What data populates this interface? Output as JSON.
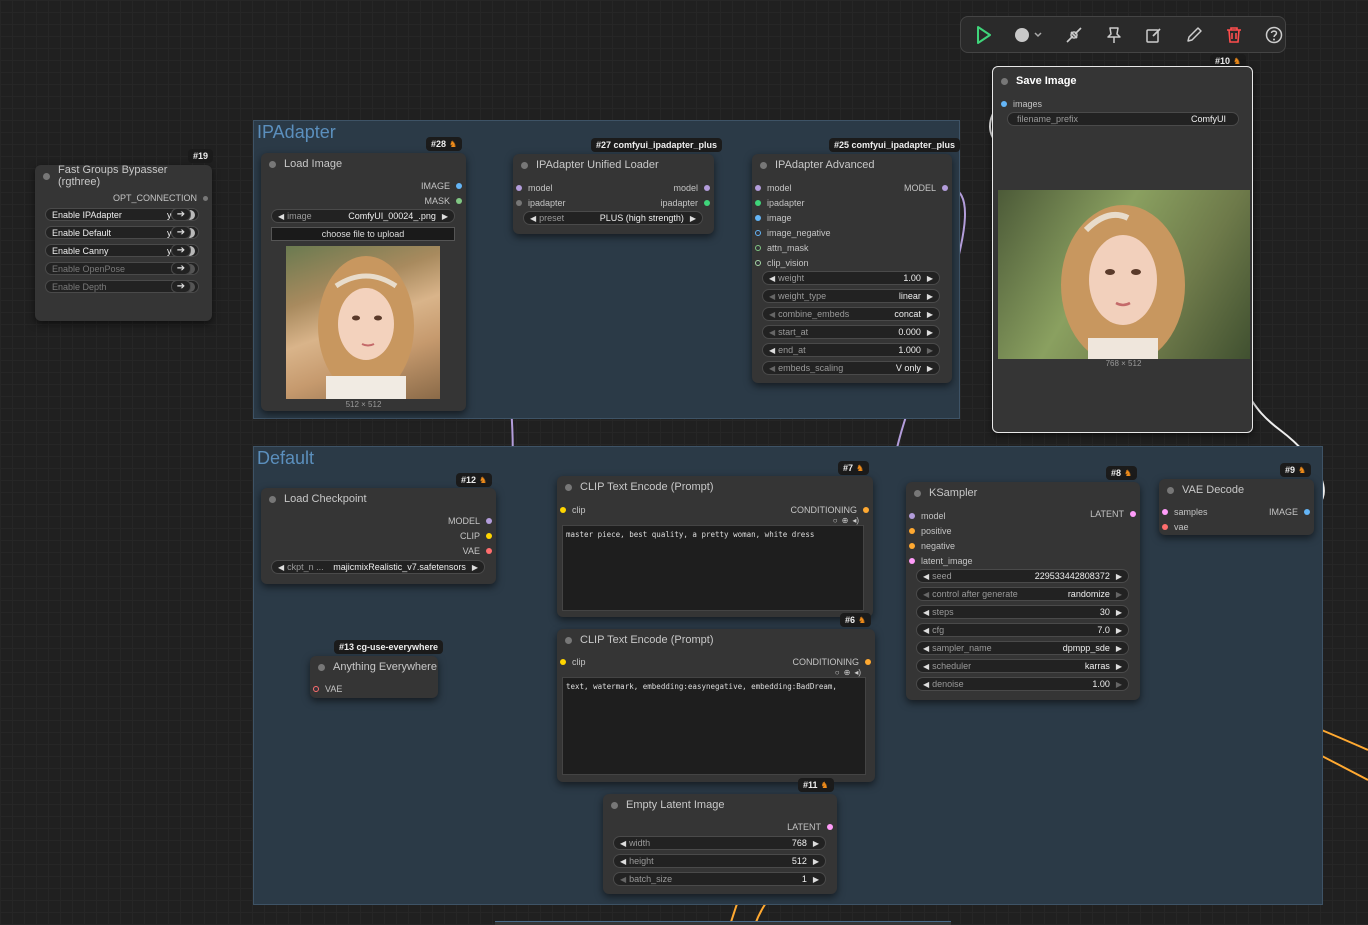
{
  "colors": {
    "model": "#b39ddb",
    "clip": "#ffd500",
    "vae": "#ff6e6e",
    "image": "#64b5f6",
    "conditioning": "#ffa931",
    "latent": "#ff9cf9",
    "ipadapter": "#3fd47a",
    "mask": "#81c784"
  },
  "toolbar": {
    "icons": [
      "play-icon",
      "color-circle-icon",
      "bypass-icon",
      "pin-icon",
      "edit-icon",
      "pencil-icon",
      "delete-icon",
      "help-icon"
    ]
  },
  "groups": {
    "ipadapter": {
      "title": "IPAdapter"
    },
    "default": {
      "title": "Default"
    }
  },
  "bypasser": {
    "badge": "#19",
    "title": "Fast Groups Bypasser (rgthree)",
    "output": "OPT_CONNECTION",
    "rows": [
      {
        "label": "Enable IPAdapter",
        "value": "yes",
        "on": true
      },
      {
        "label": "Enable Default",
        "value": "yes",
        "on": true
      },
      {
        "label": "Enable Canny",
        "value": "yes",
        "on": true
      },
      {
        "label": "Enable OpenPose",
        "value": "no",
        "on": false
      },
      {
        "label": "Enable Depth",
        "value": "no",
        "on": false
      }
    ]
  },
  "load_image": {
    "badge": "#28",
    "title": "Load Image",
    "outputs": [
      "IMAGE",
      "MASK"
    ],
    "image_label": "image",
    "image_value": "ComfyUI_00024_.png",
    "upload_label": "choose file to upload",
    "caption": "512 × 512"
  },
  "unified_loader": {
    "badge": "#27 comfyui_ipadapter_plus",
    "title": "IPAdapter Unified Loader",
    "inputs": [
      "model",
      "ipadapter"
    ],
    "outputs": [
      "model",
      "ipadapter"
    ],
    "preset_label": "preset",
    "preset_value": "PLUS (high strength)"
  },
  "ipadapter_advanced": {
    "badge": "#25 comfyui_ipadapter_plus",
    "title": "IPAdapter Advanced",
    "inputs": [
      "model",
      "ipadapter",
      "image",
      "image_negative",
      "attn_mask",
      "clip_vision"
    ],
    "output": "MODEL",
    "widgets": [
      {
        "label": "weight",
        "value": "1.00"
      },
      {
        "label": "weight_type",
        "value": "linear"
      },
      {
        "label": "combine_embeds",
        "value": "concat"
      },
      {
        "label": "start_at",
        "value": "0.000"
      },
      {
        "label": "end_at",
        "value": "1.000"
      },
      {
        "label": "embeds_scaling",
        "value": "V only"
      }
    ]
  },
  "save_image": {
    "badge": "#10",
    "title": "Save Image",
    "input": "images",
    "prefix_label": "filename_prefix",
    "prefix_value": "ComfyUI",
    "caption": "768 × 512"
  },
  "load_checkpoint": {
    "badge": "#12",
    "title": "Load Checkpoint",
    "outputs": [
      "MODEL",
      "CLIP",
      "VAE"
    ],
    "ckpt_label": "ckpt_n ...",
    "ckpt_value": "majicmixRealistic_v7.safetensors"
  },
  "clip_pos": {
    "badge": "#7",
    "title": "CLIP Text Encode (Prompt)",
    "input": "clip",
    "output": "CONDITIONING",
    "text": "master piece, best quality, a pretty woman, white dress"
  },
  "clip_neg": {
    "badge": "#6",
    "title": "CLIP Text Encode (Prompt)",
    "input": "clip",
    "output": "CONDITIONING",
    "text": "text, watermark, embedding:easynegative, embedding:BadDream,"
  },
  "anything_everywhere": {
    "badge": "#13 cg-use-everywhere",
    "title": "Anything Everywhere",
    "input": "VAE"
  },
  "ksampler": {
    "badge": "#8",
    "title": "KSampler",
    "inputs": [
      "model",
      "positive",
      "negative",
      "latent_image"
    ],
    "output": "LATENT",
    "widgets": [
      {
        "label": "seed",
        "value": "229533442808372"
      },
      {
        "label": "control after generate",
        "value": "randomize"
      },
      {
        "label": "steps",
        "value": "30"
      },
      {
        "label": "cfg",
        "value": "7.0"
      },
      {
        "label": "sampler_name",
        "value": "dpmpp_sde"
      },
      {
        "label": "scheduler",
        "value": "karras"
      },
      {
        "label": "denoise",
        "value": "1.00"
      }
    ]
  },
  "vae_decode": {
    "badge": "#9",
    "title": "VAE Decode",
    "inputs": [
      "samples",
      "vae"
    ],
    "output": "IMAGE"
  },
  "empty_latent": {
    "badge": "#11",
    "title": "Empty Latent Image",
    "output": "LATENT",
    "widgets": [
      {
        "label": "width",
        "value": "768"
      },
      {
        "label": "height",
        "value": "512"
      },
      {
        "label": "batch_size",
        "value": "1"
      }
    ]
  }
}
